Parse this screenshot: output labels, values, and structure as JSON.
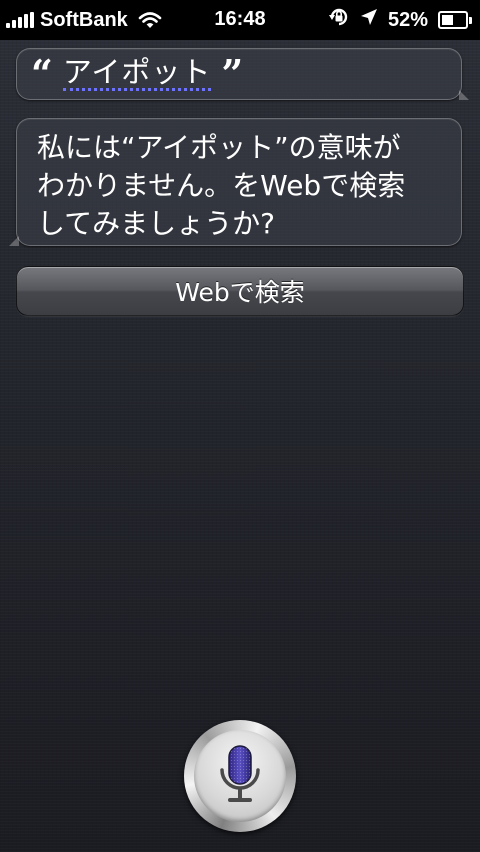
{
  "status_bar": {
    "carrier": "SoftBank",
    "time": "16:48",
    "battery_percent": "52%",
    "battery_level": 0.52,
    "signal_bars": 5
  },
  "conversation": {
    "user_query": "アイポット",
    "siri_response_lines": [
      "私には“アイポット”の意味が",
      "わかりません。をWebで検索",
      "してみましょうか?"
    ],
    "search_button_label": "Webで検索"
  },
  "icons": {
    "signal": "signal-bars-icon",
    "wifi": "wifi-icon",
    "rotation_lock": "rotation-lock-icon",
    "location": "location-arrow-icon",
    "battery": "battery-icon",
    "microphone": "microphone-icon"
  },
  "colors": {
    "mic_accent": "#4b3fa8",
    "query_underline": "#6d73ff"
  }
}
